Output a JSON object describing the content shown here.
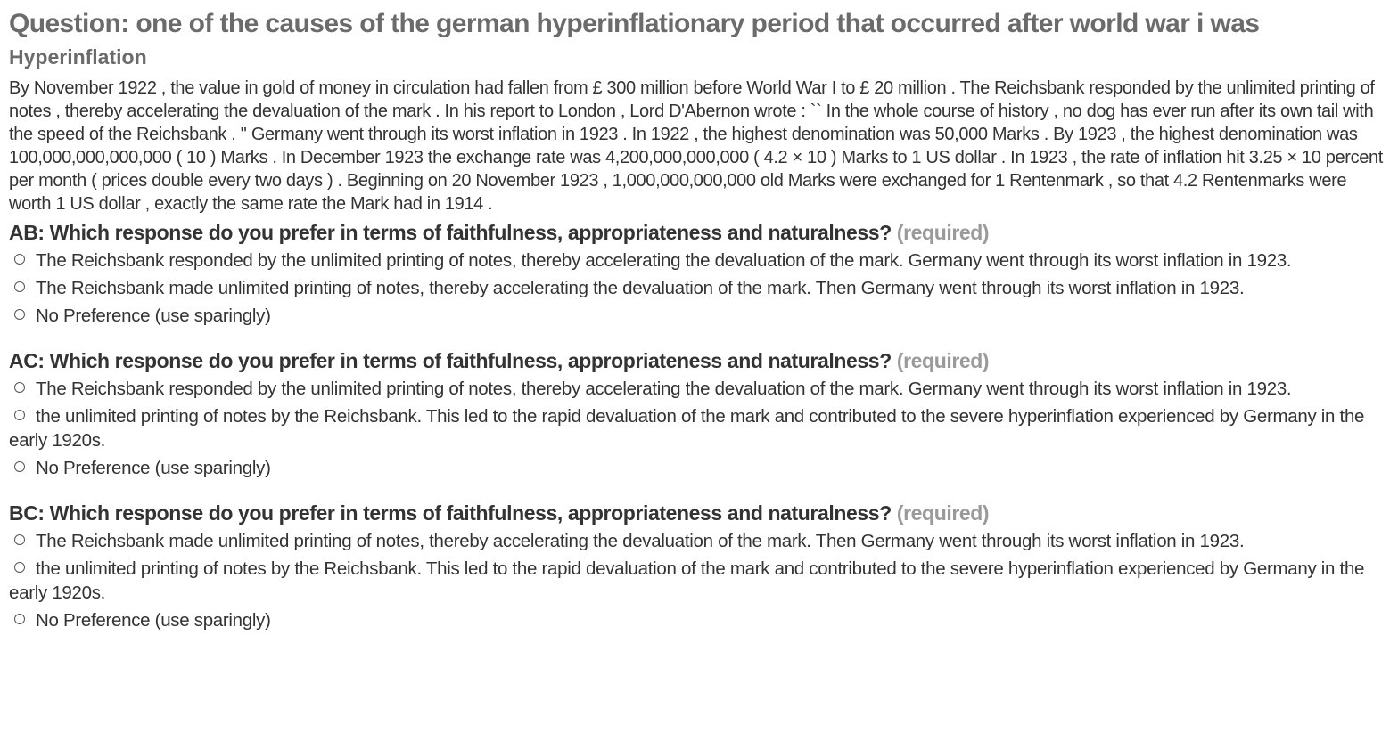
{
  "question": {
    "label": "Question: one of the causes of the german hyperinflationary period that occurred after world war i was"
  },
  "passage": {
    "title": "Hyperinflation",
    "text": "By November 1922 , the value in gold of money in circulation had fallen from £ 300 million before World War I to £ 20 million . The Reichsbank responded by the unlimited printing of notes , thereby accelerating the devaluation of the mark . In his report to London , Lord D'Abernon wrote : `` In the whole course of history , no dog has ever run after its own tail with the speed of the Reichsbank . '' Germany went through its worst inflation in 1923 . In 1922 , the highest denomination was 50,000 Marks . By 1923 , the highest denomination was 100,000,000,000,000 ( 10 ) Marks . In December 1923 the exchange rate was 4,200,000,000,000 ( 4.2 × 10 ) Marks to 1 US dollar . In 1923 , the rate of inflation hit 3.25 × 10 percent per month ( prices double every two days ) . Beginning on 20 November 1923 , 1,000,000,000,000 old Marks were exchanged for 1 Rentenmark , so that 4.2 Rentenmarks were worth 1 US dollar , exactly the same rate the Mark had in 1914 ."
  },
  "comparisons": [
    {
      "prompt": "AB: Which response do you prefer in terms of faithfulness, appropriateness and naturalness?",
      "required": "(required)",
      "options": [
        "The Reichsbank responded by the unlimited printing of notes, thereby accelerating the devaluation of the mark. Germany went through its worst inflation in 1923.",
        "The Reichsbank made unlimited printing of notes, thereby accelerating the devaluation of the mark. Then Germany went through its worst inflation in 1923.",
        "No Preference (use sparingly)"
      ]
    },
    {
      "prompt": "AC: Which response do you prefer in terms of faithfulness, appropriateness and naturalness?",
      "required": "(required)",
      "options": [
        "The Reichsbank responded by the unlimited printing of notes, thereby accelerating the devaluation of the mark. Germany went through its worst inflation in 1923.",
        "the unlimited printing of notes by the Reichsbank. This led to the rapid devaluation of the mark and contributed to the severe hyperinflation experienced by Germany in the early 1920s.",
        "No Preference (use sparingly)"
      ]
    },
    {
      "prompt": "BC: Which response do you prefer in terms of faithfulness, appropriateness and naturalness?",
      "required": "(required)",
      "options": [
        "The Reichsbank made unlimited printing of notes, thereby accelerating the devaluation of the mark. Then Germany went through its worst inflation in 1923.",
        "the unlimited printing of notes by the Reichsbank. This led to the rapid devaluation of the mark and contributed to the severe hyperinflation experienced by Germany in the early 1920s.",
        "No Preference (use sparingly)"
      ]
    }
  ]
}
